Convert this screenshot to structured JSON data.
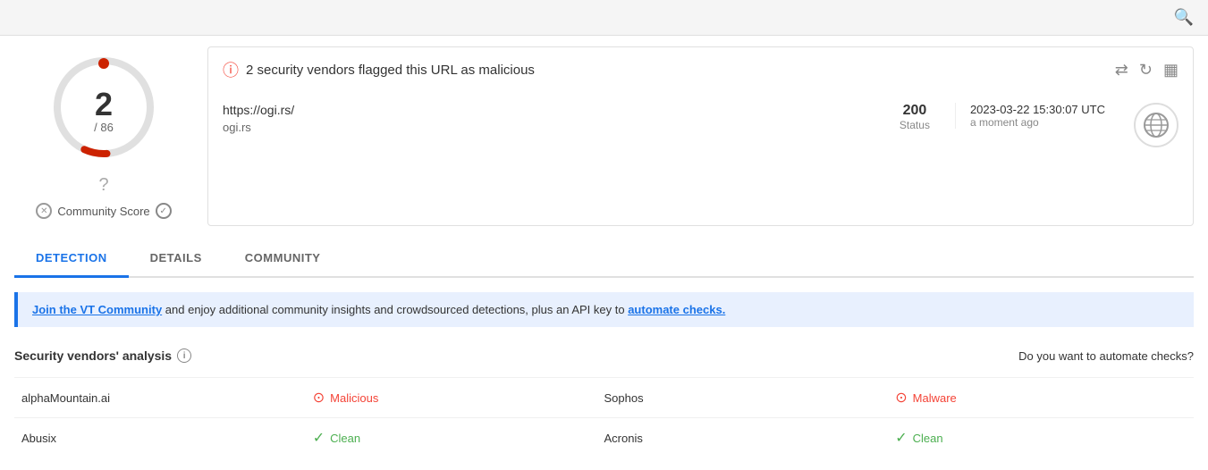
{
  "topbar": {
    "search_icon": "🔍"
  },
  "score": {
    "number": "2",
    "denominator": "/ 86",
    "question_mark": "?",
    "community_label": "Community Score"
  },
  "alert": {
    "text": "2 security vendors flagged this URL as malicious",
    "url": "https://ogi.rs/",
    "domain": "ogi.rs",
    "status_code": "200",
    "status_label": "Status",
    "date": "2023-03-22 15:30:07 UTC",
    "time_ago": "a moment ago"
  },
  "tabs": [
    {
      "label": "DETECTION",
      "active": true
    },
    {
      "label": "DETAILS",
      "active": false
    },
    {
      "label": "COMMUNITY",
      "active": false
    }
  ],
  "community_banner": {
    "link_text": "Join the VT Community",
    "middle_text": " and enjoy additional community insights and crowdsourced detections, plus an API key to ",
    "link2_text": "automate checks."
  },
  "security_section": {
    "title": "Security vendors' analysis",
    "automate_text": "Do you want to automate checks?",
    "rows": [
      {
        "vendor1": "alphaMountain.ai",
        "status1": "Malicious",
        "status1_type": "malicious",
        "vendor2": "Sophos",
        "status2": "Malware",
        "status2_type": "malicious"
      },
      {
        "vendor1": "Abusix",
        "status1": "Clean",
        "status1_type": "clean",
        "vendor2": "Acronis",
        "status2": "Clean",
        "status2_type": "clean"
      }
    ]
  }
}
